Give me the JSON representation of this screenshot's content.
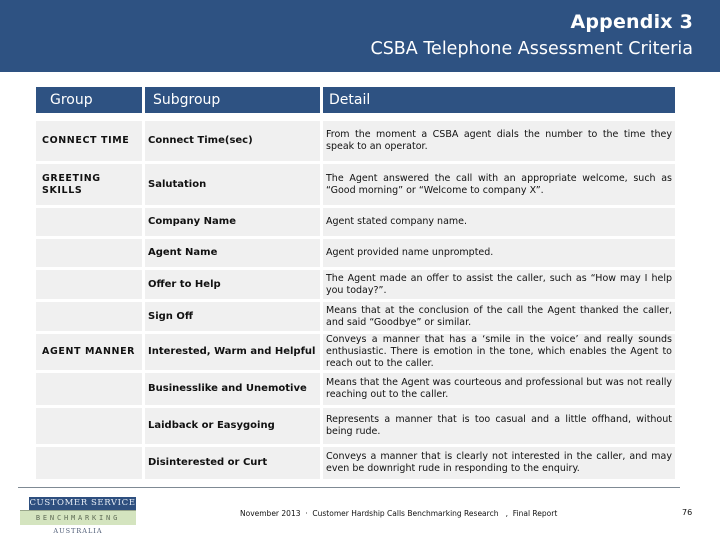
{
  "header": {
    "title": "Appendix 3",
    "subtitle": "CSBA Telephone Assessment Criteria"
  },
  "table": {
    "columns": [
      "Group",
      "Subgroup",
      "Detail"
    ],
    "rows": [
      {
        "group": "CONNECT TIME",
        "subgroup": "Connect Time(sec)",
        "detail": "From the moment a CSBA agent dials the number to the time they speak to an operator."
      },
      {
        "group": "GREETING SKILLS",
        "subgroup": "Salutation",
        "detail": "The Agent answered the call with an appropriate welcome, such as “Good morning” or “Welcome to company X”."
      },
      {
        "group": "",
        "subgroup": "Company Name",
        "detail": "Agent stated company name."
      },
      {
        "group": "",
        "subgroup": "Agent Name",
        "detail": "Agent provided name unprompted."
      },
      {
        "group": "",
        "subgroup": "Offer to Help",
        "detail": "The Agent made an offer to assist the caller, such as “How may I help you today?”."
      },
      {
        "group": "",
        "subgroup": "Sign Off",
        "detail": "Means that at the conclusion of the call the Agent thanked the caller, and said “Goodbye” or similar."
      },
      {
        "group": "AGENT MANNER",
        "subgroup": "Interested, Warm and Helpful",
        "detail": "Conveys a manner that has a ‘smile in the voice’ and really sounds enthusiastic. There is emotion in the tone, which enables the Agent to reach out to the caller."
      },
      {
        "group": "",
        "subgroup": "Businesslike and Unemotive",
        "detail": "Means that the Agent was courteous and professional but was not really reaching out to the caller."
      },
      {
        "group": "",
        "subgroup": "Laidback or Easygoing",
        "detail": "Represents a manner that is too casual and a little offhand, without being rude."
      },
      {
        "group": "",
        "subgroup": "Disinterested or Curt",
        "detail": "Conveys a manner that is clearly not interested in the caller, and may even be downright rude in responding to the enquiry."
      }
    ]
  },
  "logo": {
    "line1": "CUSTOMER SERVICE",
    "line2": "BENCHMARKING",
    "line3": "AUSTRALIA"
  },
  "footer": {
    "text": "November 2013  ·  Customer Hardship Calls Benchmarking Research   ,  Final Report",
    "page_number": "76"
  },
  "colors": {
    "brand_blue": "#2e5282",
    "cell_gray": "#f0f0f0",
    "logo_green": "#d4e4bf"
  }
}
